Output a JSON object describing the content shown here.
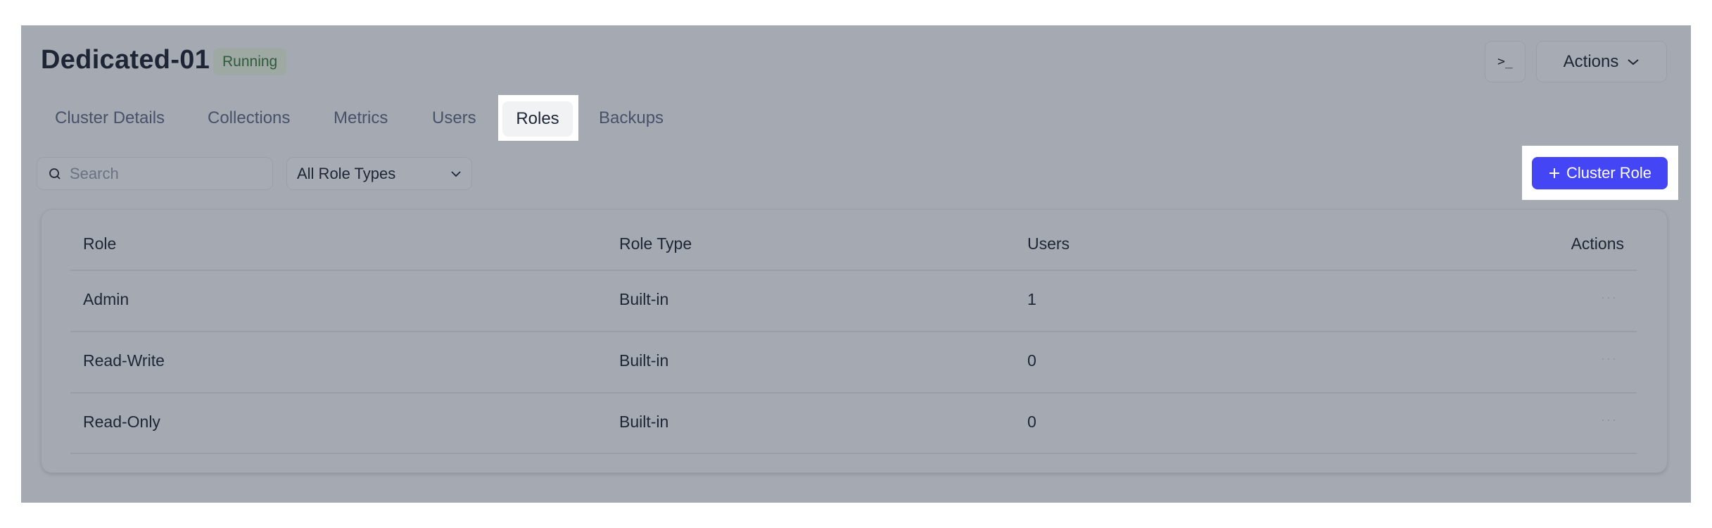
{
  "header": {
    "title": "Dedicated-01",
    "status_badge": "Running",
    "terminal_button_glyph": ">_",
    "actions_label": "Actions"
  },
  "tabs": [
    {
      "label": "Cluster Details",
      "active": false
    },
    {
      "label": "Collections",
      "active": false
    },
    {
      "label": "Metrics",
      "active": false
    },
    {
      "label": "Users",
      "active": false
    },
    {
      "label": "Roles",
      "active": true
    },
    {
      "label": "Backups",
      "active": false
    }
  ],
  "toolbar": {
    "search_placeholder": "Search",
    "search_value": "",
    "role_type_filter": "All Role Types",
    "add_role_label": "Cluster Role"
  },
  "table": {
    "columns": [
      "Role",
      "Role Type",
      "Users",
      "Actions"
    ],
    "rows": [
      {
        "role": "Admin",
        "role_type": "Built-in",
        "users": "1",
        "actions": "···"
      },
      {
        "role": "Read-Write",
        "role_type": "Built-in",
        "users": "0",
        "actions": "···"
      },
      {
        "role": "Read-Only",
        "role_type": "Built-in",
        "users": "0",
        "actions": "···"
      }
    ]
  },
  "colors": {
    "primary": "#4446f5",
    "overlay": "#a5a9b1",
    "status_text": "#2f5a3c"
  }
}
